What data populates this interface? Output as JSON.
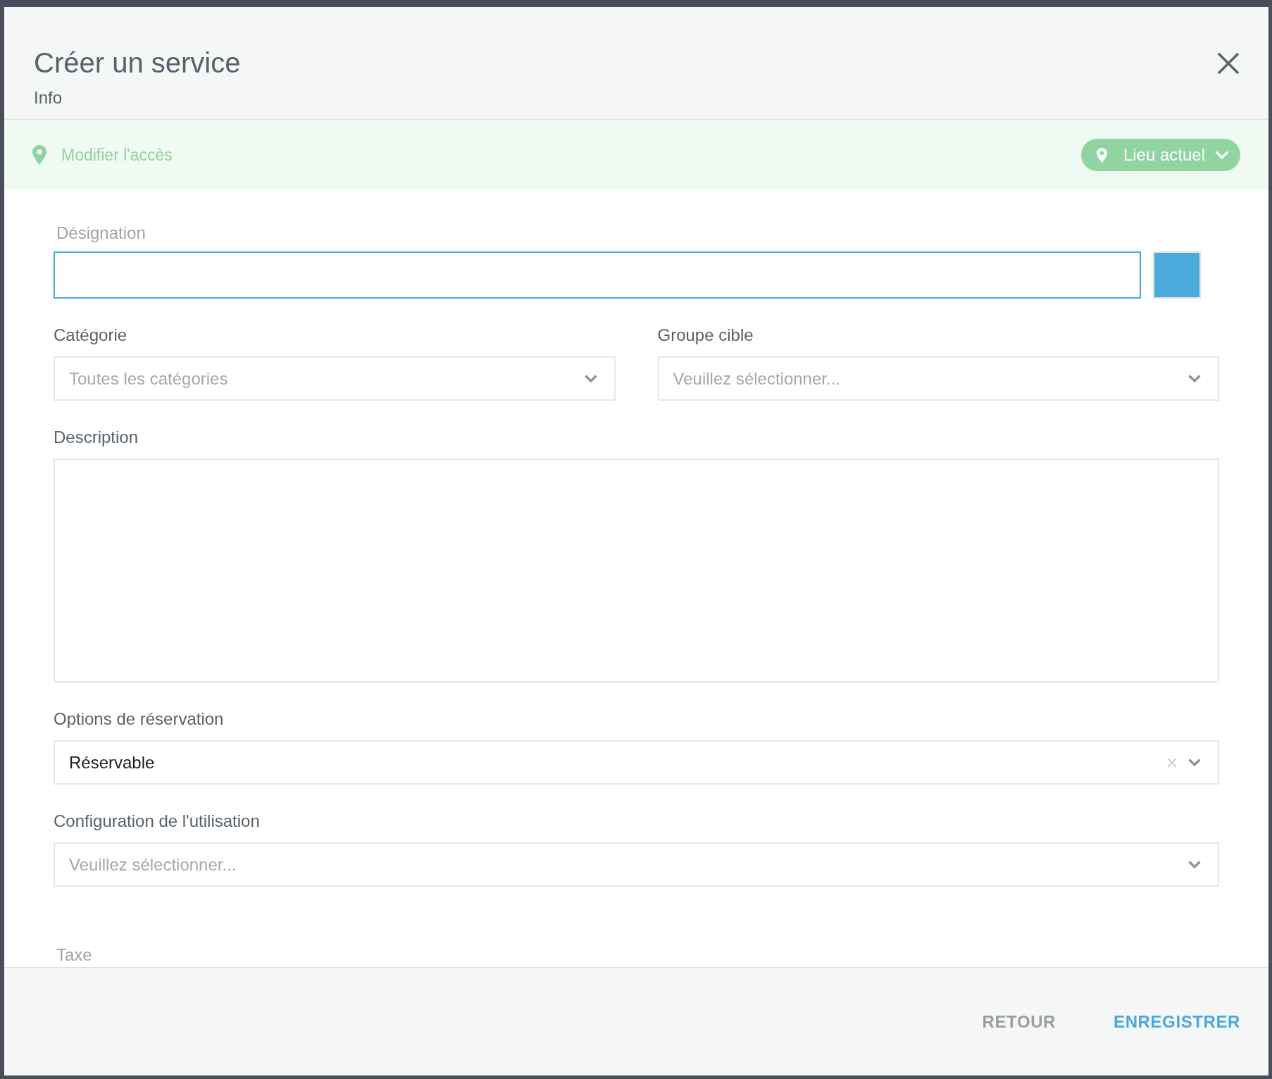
{
  "dialog": {
    "title": "Créer un service",
    "subtitle": "Info"
  },
  "access_bar": {
    "link": "Modifier l'accès",
    "location_button": "Lieu actuel"
  },
  "form": {
    "rows": [
      {
        "fields": [
          {
            "kind": "text",
            "label": "Désignation",
            "focused": true,
            "color": "#4aabdc"
          }
        ]
      },
      {
        "fields": [
          {
            "kind": "select",
            "label": "Catégorie",
            "placeholder": "Toutes les catégories",
            "focused": false,
            "clearable": false
          },
          {
            "kind": "select",
            "label": "Groupe cible",
            "placeholder": "Veuillez sélectionner...",
            "focused": false,
            "clearable": false
          }
        ]
      },
      {
        "fields": [
          {
            "kind": "textarea",
            "label": "Description",
            "focused": false
          }
        ]
      },
      {
        "fields": [
          {
            "kind": "select",
            "label": "Options de réservation",
            "value": "Réservable",
            "focused": false,
            "clearable": true
          }
        ]
      },
      {
        "fields": [
          {
            "kind": "select",
            "label": "Configuration de l'utilisation",
            "placeholder": "Veuillez sélectionner...",
            "focused": false,
            "clearable": false
          }
        ]
      }
    ],
    "cut_off_label": "Taxe"
  },
  "footer": {
    "buttons": [
      {
        "kind": "secondary",
        "label": "RETOUR"
      },
      {
        "kind": "primary",
        "label": "ENREGISTRER"
      }
    ]
  }
}
